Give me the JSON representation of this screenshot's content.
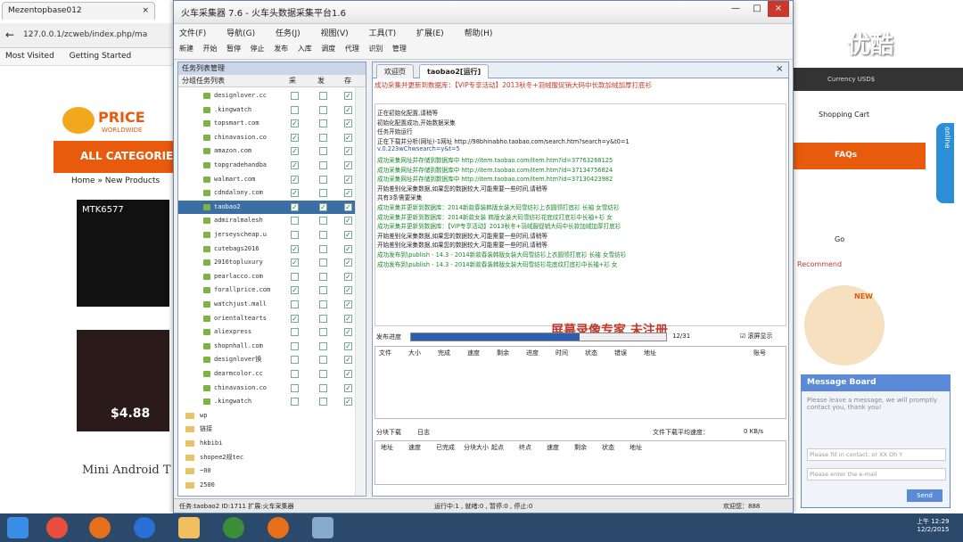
{
  "browser": {
    "tab_title": "Mezentopbase012",
    "url": "127.0.0.1/zcweb/index.php/ma",
    "bookmarks": [
      "Most Visited",
      "Getting Started"
    ],
    "nav": "ALL CATEGORIE",
    "breadcrumb": "Home » New Products",
    "price": "$4.88",
    "ad": "Mini Android T",
    "logo": "PRICE",
    "logo_sub": "WORLDWIDE",
    "phone": "MTK6577"
  },
  "right": {
    "currency": "Currency USD$",
    "cart": "Shopping Cart",
    "faqs": "FAQs",
    "go": "Go",
    "recommend": "Recommend",
    "new": "NEW",
    "online": "online"
  },
  "message_board": {
    "title": "Message Board",
    "hint": "Please leave a message, we will promptly contact you, thank you!",
    "contact_placeholder": "Please fill in contact, or XX Dh Y",
    "email_placeholder": "Please enter the e-mail",
    "send": "Send"
  },
  "app": {
    "title": "火车采集器 7.6 - 火车头数据采集平台1.6",
    "menu": [
      "文件(F)",
      "导航(G)",
      "任务(J)",
      "视图(V)",
      "工具(T)",
      "扩展(E)",
      "帮助(H)"
    ],
    "toolbar": [
      "新建",
      "开始",
      "暂停",
      "停止",
      "发布",
      "入库",
      "调度",
      "代理",
      "识别",
      "管理"
    ],
    "tree_title": "任务列表管理",
    "tree_cols": [
      "分组任务列表",
      "采",
      "发",
      "存"
    ],
    "tree_items": [
      {
        "name": "designlover.cc",
        "c": [
          false,
          false,
          true
        ],
        "sel": false
      },
      {
        "name": ".kingwatch",
        "c": [
          false,
          false,
          true
        ],
        "sel": false
      },
      {
        "name": "topsmart.com",
        "c": [
          true,
          false,
          true
        ],
        "sel": false
      },
      {
        "name": "chinavasion.co",
        "c": [
          true,
          false,
          true
        ],
        "sel": false
      },
      {
        "name": "amazon.com",
        "c": [
          true,
          false,
          true
        ],
        "sel": false
      },
      {
        "name": "topgradehandba",
        "c": [
          true,
          false,
          true
        ],
        "sel": false
      },
      {
        "name": "walmart.com",
        "c": [
          true,
          false,
          true
        ],
        "sel": false
      },
      {
        "name": "cdndalony.com",
        "c": [
          true,
          false,
          true
        ],
        "sel": false
      },
      {
        "name": "taobao2",
        "c": [
          true,
          true,
          true
        ],
        "sel": true
      },
      {
        "name": "admiralmalesh",
        "c": [
          false,
          false,
          true
        ],
        "sel": false
      },
      {
        "name": "jerseyscheap.u",
        "c": [
          false,
          false,
          true
        ],
        "sel": false
      },
      {
        "name": "cutebags2016",
        "c": [
          true,
          false,
          true
        ],
        "sel": false
      },
      {
        "name": "2016topluxury",
        "c": [
          true,
          false,
          true
        ],
        "sel": false
      },
      {
        "name": "pearlacco.com",
        "c": [
          false,
          false,
          true
        ],
        "sel": false
      },
      {
        "name": "forallprice.com",
        "c": [
          true,
          false,
          true
        ],
        "sel": false
      },
      {
        "name": "watchjust.mall",
        "c": [
          false,
          false,
          true
        ],
        "sel": false
      },
      {
        "name": "orientaltearts",
        "c": [
          true,
          false,
          true
        ],
        "sel": false
      },
      {
        "name": "aliexpress",
        "c": [
          false,
          false,
          true
        ],
        "sel": false
      },
      {
        "name": "shopnhall.com",
        "c": [
          false,
          false,
          true
        ],
        "sel": false
      },
      {
        "name": "designlover换",
        "c": [
          false,
          false,
          true
        ],
        "sel": false
      },
      {
        "name": "dearmcolor.cc",
        "c": [
          false,
          false,
          true
        ],
        "sel": false
      },
      {
        "name": "chinavasion.co",
        "c": [
          false,
          false,
          true
        ],
        "sel": false
      },
      {
        "name": ".kingwatch",
        "c": [
          false,
          false,
          true
        ],
        "sel": false
      }
    ],
    "folders": [
      "wp",
      "链接",
      "hkbibi",
      "shopee2规tec",
      "~00",
      "2500"
    ],
    "tabs": [
      "欢迎页",
      "taobao2[运行]"
    ],
    "banner": "成功采集并更新到数据库：【VIP专享活动】2013秋冬+羽绒服促销大码中长款加绒加厚打底衫",
    "log": [
      {
        "t": "正在初始化配置,请稍等",
        "c": "#222"
      },
      {
        "t": "初始化配置成功,开始数据采集",
        "c": "#222"
      },
      {
        "t": "任务开始运行",
        "c": "#222"
      },
      {
        "t": "正在下载并分析(网址)-1网址 http://98bhinabho.taobao.com/search.htm?search=y&t0=1",
        "c": "#222"
      },
      {
        "t": "v.0.223wChwsearch=y&t=5",
        "c": "#2a4ea0"
      },
      {
        "t": "成功采集网址并存储到数据库中 http://item.taobao.com/item.htm?id=37763268125",
        "c": "#1a8a2a"
      },
      {
        "t": "成功采集网址并存储到数据库中 http://item.taobao.com/item.htm?id=37134756824",
        "c": "#1a8a2a"
      },
      {
        "t": "成功采集网址并存储到数据库中 http://item.taobao.com/item.htm?id=37130423982",
        "c": "#1a8a2a"
      },
      {
        "t": "开始差别化采集数据,如果您的数据较大,可能需要一些时间,请稍等",
        "c": "#222"
      },
      {
        "t": "共有3条需要采集",
        "c": "#222"
      },
      {
        "t": "成功采集并更新到数据库：2014新款春装韩版女装大码雪纺衫上衣圆领打底衫 长袖 女雪纺衫",
        "c": "#1a8a2a"
      },
      {
        "t": "成功采集并更新到数据库：2014新款女装 韩版女装大码雪纺衫花底纹打底衫中长袖+衫 女",
        "c": "#1a8a2a"
      },
      {
        "t": "成功采集并更新到数据库：【VIP专享活动】2013秋冬+羽绒服促销大码中长款加绒加厚打底衫",
        "c": "#1a8a2a"
      },
      {
        "t": "开始差别化采集数据,如果您的数据较大,可能需要一些时间,请稍等",
        "c": "#222"
      },
      {
        "t": "开始差别化采集数据,如果您的数据较大,可能需要一些时间,请稍等",
        "c": "#222"
      },
      {
        "t": "成功发布到\\publish - 14.3 - 2014新款春装韩版女装大码雪纺衫上衣圆领打底衫 长袖 女雪纺衫",
        "c": "#1a8a2a"
      },
      {
        "t": "成功发布到\\publish - 14.3 - 2014新款春装韩版女装大码雪纺衫花底纹打底衫中长袖+衫 女",
        "c": "#1a8a2a"
      }
    ],
    "watermark": "屏幕录像专家 未注册",
    "progress": {
      "label": "发布进度",
      "value": 0.66,
      "text": "12/31",
      "check": "滚屏显示"
    },
    "grid1_cols": [
      "文件",
      "大小",
      "完成",
      "速度",
      "剩余",
      "进度",
      "时间",
      "状态",
      "错误",
      "地址",
      "账号"
    ],
    "bottom_tabs": [
      "分块下载",
      "日志"
    ],
    "bottom_speed": "文件下载平均速度：",
    "bottom_speed_val": "0 KB/s",
    "grid2_cols": [
      "地址",
      "速度",
      "已完成",
      "分块大小",
      "起点",
      "终点",
      "速度",
      "剩余",
      "状态",
      "地址"
    ],
    "status_left": "任务:taobao2  ID:1711  扩展:火车采集器",
    "status_mid": "运行中:1 , 就绪:0 , 暂停:0 , 停止:0",
    "status_right": "欢迎您：888"
  },
  "taskbar": {
    "time": "上午 12:29",
    "date": "12/2/2015"
  }
}
